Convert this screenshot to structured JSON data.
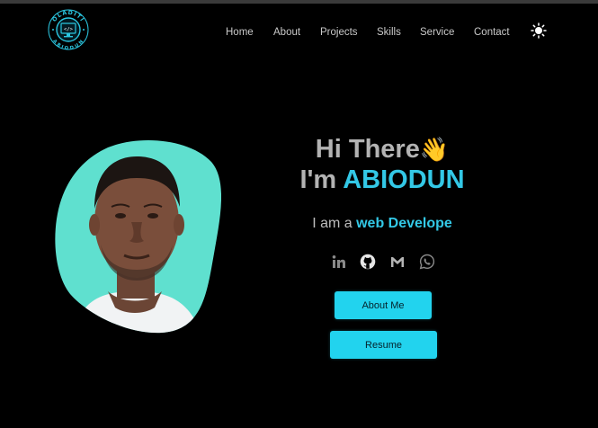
{
  "header": {
    "logo": {
      "top_text": "OLADITI",
      "bottom_text": "ABIODUN",
      "center_glyph": "</>",
      "icon": "code-monitor-logo"
    },
    "nav": [
      "Home",
      "About",
      "Projects",
      "Skills",
      "Service",
      "Contact"
    ],
    "theme_toggle_icon": "sun-icon"
  },
  "hero": {
    "greeting": "Hi There",
    "greeting_emoji": "👋",
    "name_prefix": "I'm ",
    "name": "ABIODUN",
    "role_prefix": "I am a",
    "role_value": "web Develope",
    "social_icons": [
      "linkedin-icon",
      "github-icon",
      "gmail-icon",
      "whatsapp-icon"
    ],
    "buttons": {
      "about": "About Me",
      "resume": "Resume"
    }
  },
  "colors": {
    "background": "#000000",
    "accent": "#33c8e6",
    "button": "#22d3ee",
    "muted_text": "#b3b3b3",
    "avatar_bg": "#5fe0cf"
  }
}
